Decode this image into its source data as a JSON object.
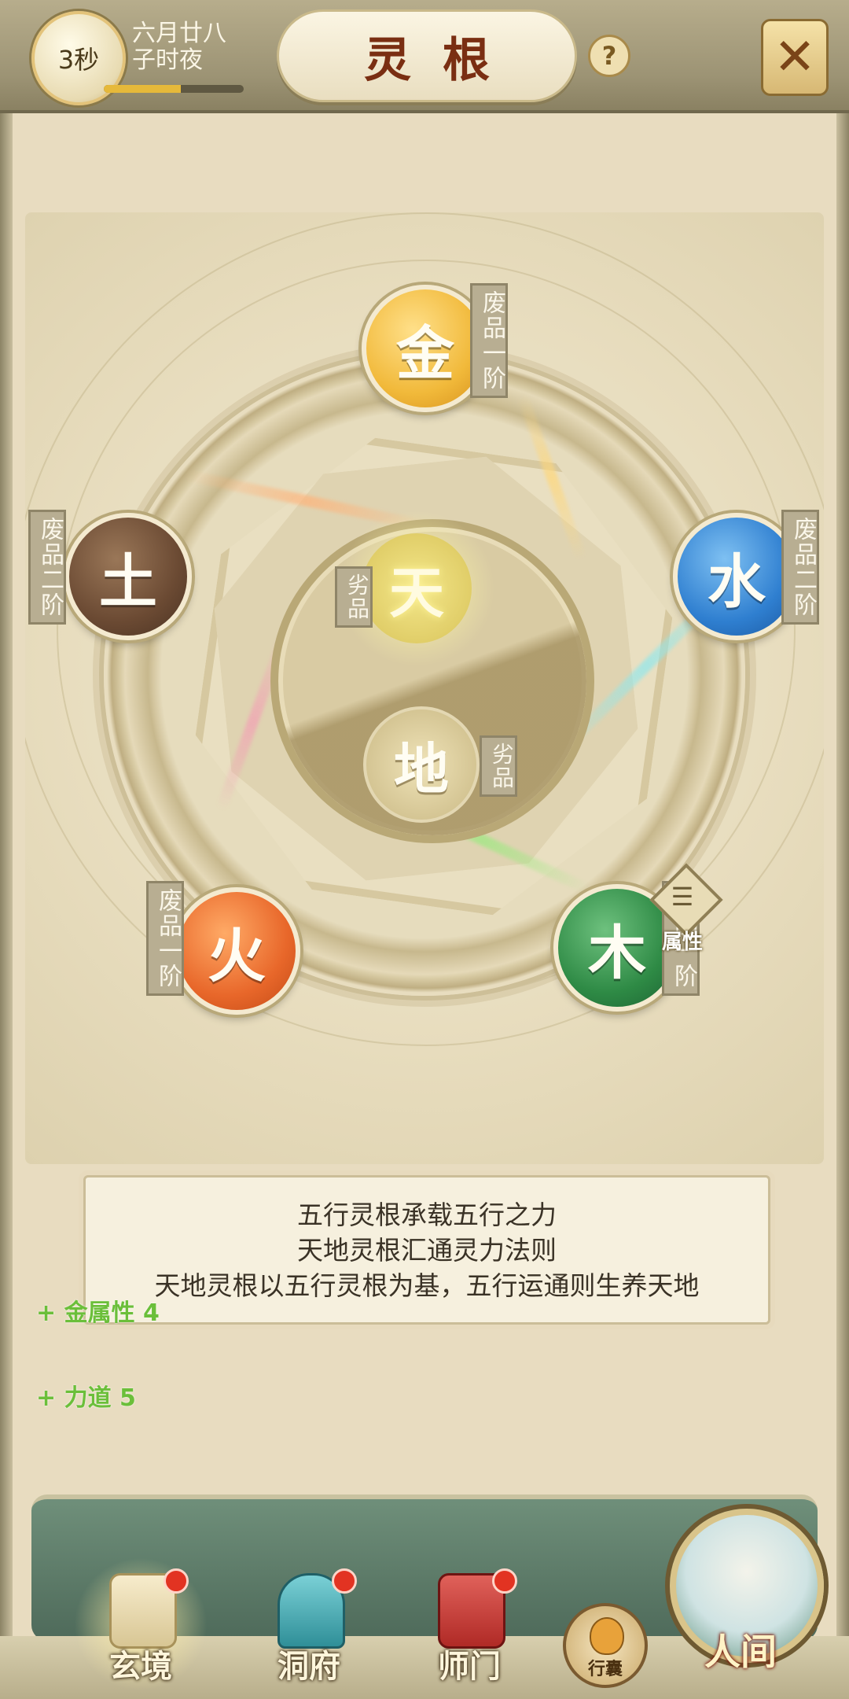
{
  "header": {
    "timer": "3秒",
    "date_line1": "六月廿八",
    "date_line2": "子时夜",
    "day_progress": 0.55,
    "title": "灵根",
    "help": "?",
    "close": "✕"
  },
  "elements": {
    "metal": {
      "char": "金",
      "grade": "废品一阶",
      "color": "#f1b93a"
    },
    "water": {
      "char": "水",
      "grade": "废品二阶",
      "color": "#2f7fd0"
    },
    "wood": {
      "char": "木",
      "grade": "废品一阶",
      "color": "#2e8a45"
    },
    "fire": {
      "char": "火",
      "grade": "废品一阶",
      "color": "#e8672a"
    },
    "earth": {
      "char": "土",
      "grade": "废品二阶",
      "color": "#6b4a33"
    }
  },
  "center": {
    "heaven": {
      "char": "天",
      "grade": "劣品"
    },
    "earth": {
      "char": "地",
      "grade": "劣品"
    }
  },
  "attribute_button": {
    "icon": "☰",
    "label": "属性"
  },
  "description": [
    "五行灵根承载五行之力",
    "天地灵根汇通灵力法则",
    "天地灵根以五行灵根为基，五行运通则生养天地"
  ],
  "bonuses": [
    "+ 金属性 4",
    "+ 力道 5"
  ],
  "nav": {
    "items": [
      {
        "label": "玄境",
        "badge": true
      },
      {
        "label": "洞府",
        "badge": true
      },
      {
        "label": "师门",
        "badge": true
      }
    ],
    "bag_label": "行囊",
    "world_label": "人间"
  }
}
